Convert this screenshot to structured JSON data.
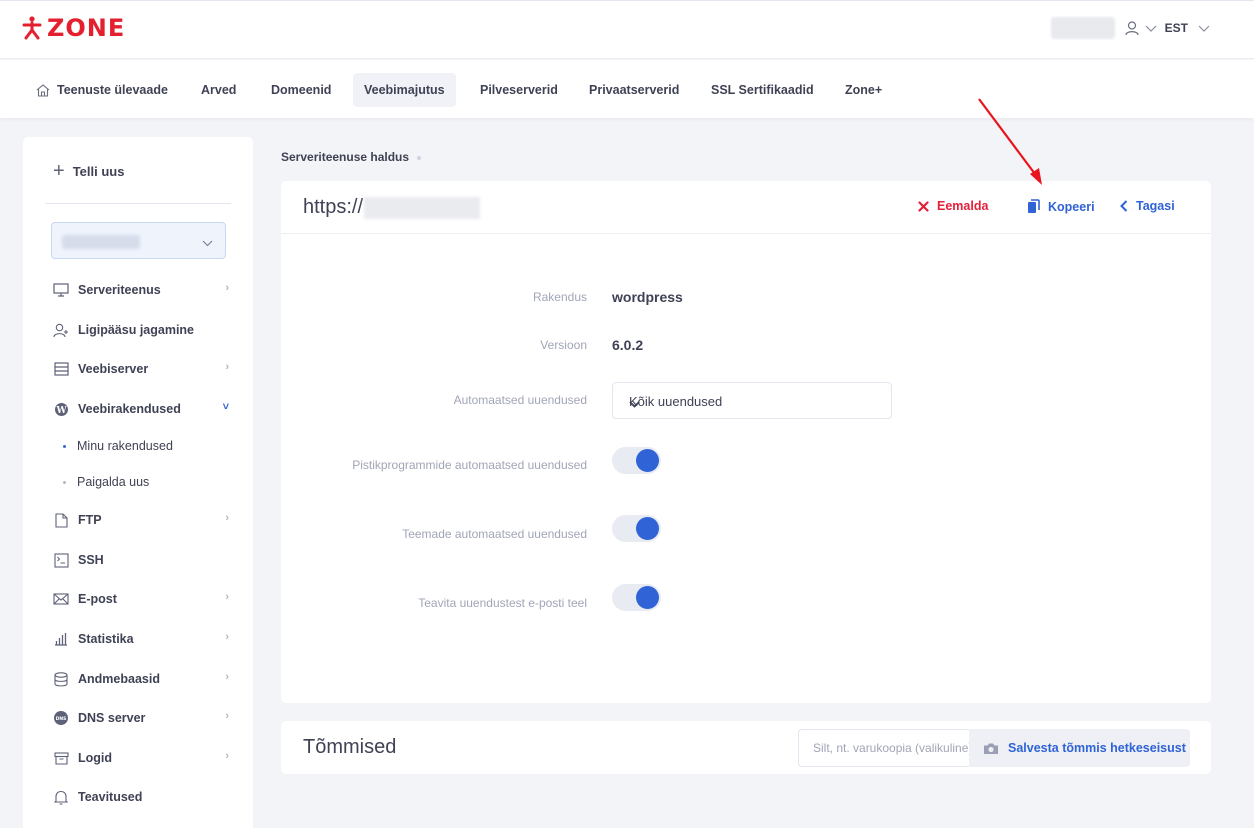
{
  "header": {
    "logo_text": "ZONE",
    "language": "EST"
  },
  "nav": {
    "items": [
      {
        "label": "Teenuste ülevaade"
      },
      {
        "label": "Arved"
      },
      {
        "label": "Domeenid"
      },
      {
        "label": "Veebimajutus",
        "active": true
      },
      {
        "label": "Pilveserverid"
      },
      {
        "label": "Privaatserverid"
      },
      {
        "label": "SSL Sertifikaadid"
      },
      {
        "label": "Zone+"
      }
    ]
  },
  "sidebar": {
    "order_new": "Telli uus",
    "items": [
      {
        "label": "Serveriteenus",
        "icon": "monitor-icon"
      },
      {
        "label": "Ligipääsu jagamine",
        "icon": "user-plus-icon"
      },
      {
        "label": "Veebiserver",
        "icon": "server-icon"
      },
      {
        "label": "Veebirakendused",
        "icon": "wordpress-icon"
      },
      {
        "label": "FTP",
        "icon": "file-icon"
      },
      {
        "label": "SSH",
        "icon": "terminal-icon"
      },
      {
        "label": "E-post",
        "icon": "mail-icon"
      },
      {
        "label": "Statistika",
        "icon": "bar-chart-icon"
      },
      {
        "label": "Andmebaasid",
        "icon": "database-icon"
      },
      {
        "label": "DNS server",
        "icon": "dns-icon"
      },
      {
        "label": "Logid",
        "icon": "archive-icon"
      },
      {
        "label": "Teavitused",
        "icon": "bell-icon"
      }
    ],
    "subitems": [
      {
        "label": "Minu rakendused",
        "active": true
      },
      {
        "label": "Paigalda uus"
      }
    ]
  },
  "breadcrumb": "Serveriteenuse haldus",
  "card": {
    "url_prefix": "https://",
    "actions": {
      "remove": "Eemalda",
      "copy": "Kopeeri",
      "back": "Tagasi"
    },
    "fields": {
      "app_label": "Rakendus",
      "app_value": "wordpress",
      "version_label": "Versioon",
      "version_value": "6.0.2",
      "auto_updates_label": "Automaatsed uuendused",
      "auto_updates_value": "Kõik uuendused",
      "plugin_updates_label": "Pistikprogrammide automaatsed uuendused",
      "plugin_updates_on": true,
      "theme_updates_label": "Teemade automaatsed uuendused",
      "theme_updates_on": true,
      "notify_label": "Teavita uuendustest e-posti teel",
      "notify_on": true
    }
  },
  "snapshots": {
    "title": "Tõmmised",
    "input_placeholder": "Silt, nt. varukoopia (valikuline)",
    "save_button": "Salvesta tõmmis hetkeseisust"
  },
  "colors": {
    "brand": "#e5202e",
    "accent": "#2f63d6",
    "danger": "#e5203a"
  }
}
